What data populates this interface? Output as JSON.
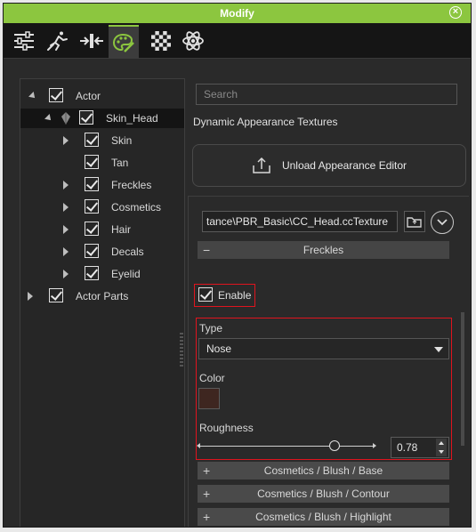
{
  "window": {
    "title": "Modify",
    "close_icon": "close-icon"
  },
  "toolbar": {
    "tools": [
      {
        "icon": "sliders-icon",
        "active": false
      },
      {
        "icon": "motion-figure-icon",
        "active": false
      },
      {
        "icon": "align-arrows-icon",
        "active": false
      },
      {
        "icon": "palette-icon",
        "active": true
      },
      {
        "icon": "checker-texture-icon",
        "active": false
      },
      {
        "icon": "atom-icon",
        "active": false
      }
    ]
  },
  "tree": {
    "items": [
      {
        "label": "Actor",
        "level": 0,
        "expanded": true,
        "checked": true
      },
      {
        "label": "Skin_Head",
        "level": 1,
        "expanded": true,
        "checked": true,
        "selected": true
      },
      {
        "label": "Skin",
        "level": 2,
        "expandable": true,
        "checked": true
      },
      {
        "label": "Tan",
        "level": 2,
        "expandable": false,
        "checked": true
      },
      {
        "label": "Freckles",
        "level": 2,
        "expandable": true,
        "checked": true
      },
      {
        "label": "Cosmetics",
        "level": 2,
        "expandable": true,
        "checked": true
      },
      {
        "label": "Hair",
        "level": 2,
        "expandable": true,
        "checked": true
      },
      {
        "label": "Decals",
        "level": 2,
        "expandable": true,
        "checked": true
      },
      {
        "label": "Eyelid",
        "level": 2,
        "expandable": true,
        "checked": true
      },
      {
        "label": "Actor Parts",
        "level": 0,
        "expandable": true,
        "checked": true
      }
    ]
  },
  "search": {
    "placeholder": "Search"
  },
  "main": {
    "section_title": "Dynamic Appearance Textures",
    "unload_label": "Unload Appearance Editor",
    "path_value": "tance\\PBR_Basic\\CC_Head.ccTexture"
  },
  "freckles": {
    "header": "Freckles",
    "enable_label": "Enable",
    "type_label": "Type",
    "type_value": "Nose",
    "color_label": "Color",
    "color_value": "#3e2620",
    "roughness_label": "Roughness",
    "roughness_value": "0.78",
    "roughness_fraction": 0.78
  },
  "groups": [
    "Cosmetics / Blush / Base",
    "Cosmetics / Blush / Contour",
    "Cosmetics / Blush / Highlight"
  ],
  "colors": {
    "accent": "#8cc63f",
    "highlight_box": "#e0141e"
  }
}
